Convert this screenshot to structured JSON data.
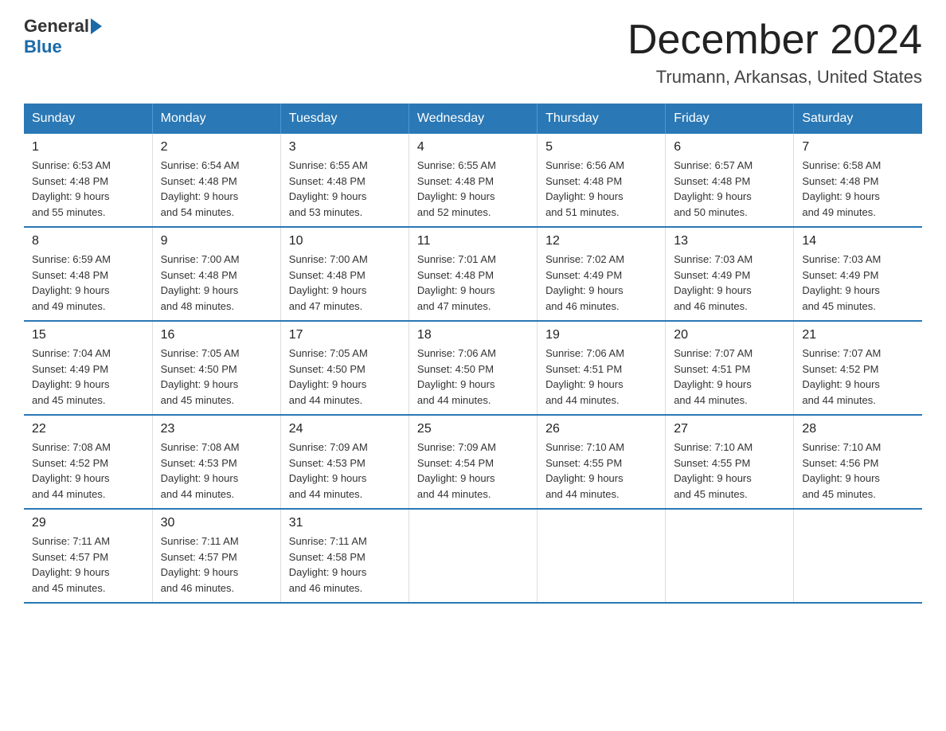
{
  "header": {
    "logo_general": "General",
    "logo_blue": "Blue",
    "month_title": "December 2024",
    "location": "Trumann, Arkansas, United States"
  },
  "weekdays": [
    "Sunday",
    "Monday",
    "Tuesday",
    "Wednesday",
    "Thursday",
    "Friday",
    "Saturday"
  ],
  "weeks": [
    [
      {
        "day": "1",
        "sunrise": "6:53 AM",
        "sunset": "4:48 PM",
        "daylight": "9 hours and 55 minutes."
      },
      {
        "day": "2",
        "sunrise": "6:54 AM",
        "sunset": "4:48 PM",
        "daylight": "9 hours and 54 minutes."
      },
      {
        "day": "3",
        "sunrise": "6:55 AM",
        "sunset": "4:48 PM",
        "daylight": "9 hours and 53 minutes."
      },
      {
        "day": "4",
        "sunrise": "6:55 AM",
        "sunset": "4:48 PM",
        "daylight": "9 hours and 52 minutes."
      },
      {
        "day": "5",
        "sunrise": "6:56 AM",
        "sunset": "4:48 PM",
        "daylight": "9 hours and 51 minutes."
      },
      {
        "day": "6",
        "sunrise": "6:57 AM",
        "sunset": "4:48 PM",
        "daylight": "9 hours and 50 minutes."
      },
      {
        "day": "7",
        "sunrise": "6:58 AM",
        "sunset": "4:48 PM",
        "daylight": "9 hours and 49 minutes."
      }
    ],
    [
      {
        "day": "8",
        "sunrise": "6:59 AM",
        "sunset": "4:48 PM",
        "daylight": "9 hours and 49 minutes."
      },
      {
        "day": "9",
        "sunrise": "7:00 AM",
        "sunset": "4:48 PM",
        "daylight": "9 hours and 48 minutes."
      },
      {
        "day": "10",
        "sunrise": "7:00 AM",
        "sunset": "4:48 PM",
        "daylight": "9 hours and 47 minutes."
      },
      {
        "day": "11",
        "sunrise": "7:01 AM",
        "sunset": "4:48 PM",
        "daylight": "9 hours and 47 minutes."
      },
      {
        "day": "12",
        "sunrise": "7:02 AM",
        "sunset": "4:49 PM",
        "daylight": "9 hours and 46 minutes."
      },
      {
        "day": "13",
        "sunrise": "7:03 AM",
        "sunset": "4:49 PM",
        "daylight": "9 hours and 46 minutes."
      },
      {
        "day": "14",
        "sunrise": "7:03 AM",
        "sunset": "4:49 PM",
        "daylight": "9 hours and 45 minutes."
      }
    ],
    [
      {
        "day": "15",
        "sunrise": "7:04 AM",
        "sunset": "4:49 PM",
        "daylight": "9 hours and 45 minutes."
      },
      {
        "day": "16",
        "sunrise": "7:05 AM",
        "sunset": "4:50 PM",
        "daylight": "9 hours and 45 minutes."
      },
      {
        "day": "17",
        "sunrise": "7:05 AM",
        "sunset": "4:50 PM",
        "daylight": "9 hours and 44 minutes."
      },
      {
        "day": "18",
        "sunrise": "7:06 AM",
        "sunset": "4:50 PM",
        "daylight": "9 hours and 44 minutes."
      },
      {
        "day": "19",
        "sunrise": "7:06 AM",
        "sunset": "4:51 PM",
        "daylight": "9 hours and 44 minutes."
      },
      {
        "day": "20",
        "sunrise": "7:07 AM",
        "sunset": "4:51 PM",
        "daylight": "9 hours and 44 minutes."
      },
      {
        "day": "21",
        "sunrise": "7:07 AM",
        "sunset": "4:52 PM",
        "daylight": "9 hours and 44 minutes."
      }
    ],
    [
      {
        "day": "22",
        "sunrise": "7:08 AM",
        "sunset": "4:52 PM",
        "daylight": "9 hours and 44 minutes."
      },
      {
        "day": "23",
        "sunrise": "7:08 AM",
        "sunset": "4:53 PM",
        "daylight": "9 hours and 44 minutes."
      },
      {
        "day": "24",
        "sunrise": "7:09 AM",
        "sunset": "4:53 PM",
        "daylight": "9 hours and 44 minutes."
      },
      {
        "day": "25",
        "sunrise": "7:09 AM",
        "sunset": "4:54 PM",
        "daylight": "9 hours and 44 minutes."
      },
      {
        "day": "26",
        "sunrise": "7:10 AM",
        "sunset": "4:55 PM",
        "daylight": "9 hours and 44 minutes."
      },
      {
        "day": "27",
        "sunrise": "7:10 AM",
        "sunset": "4:55 PM",
        "daylight": "9 hours and 45 minutes."
      },
      {
        "day": "28",
        "sunrise": "7:10 AM",
        "sunset": "4:56 PM",
        "daylight": "9 hours and 45 minutes."
      }
    ],
    [
      {
        "day": "29",
        "sunrise": "7:11 AM",
        "sunset": "4:57 PM",
        "daylight": "9 hours and 45 minutes."
      },
      {
        "day": "30",
        "sunrise": "7:11 AM",
        "sunset": "4:57 PM",
        "daylight": "9 hours and 46 minutes."
      },
      {
        "day": "31",
        "sunrise": "7:11 AM",
        "sunset": "4:58 PM",
        "daylight": "9 hours and 46 minutes."
      },
      null,
      null,
      null,
      null
    ]
  ],
  "labels": {
    "sunrise": "Sunrise:",
    "sunset": "Sunset:",
    "daylight": "Daylight:"
  }
}
